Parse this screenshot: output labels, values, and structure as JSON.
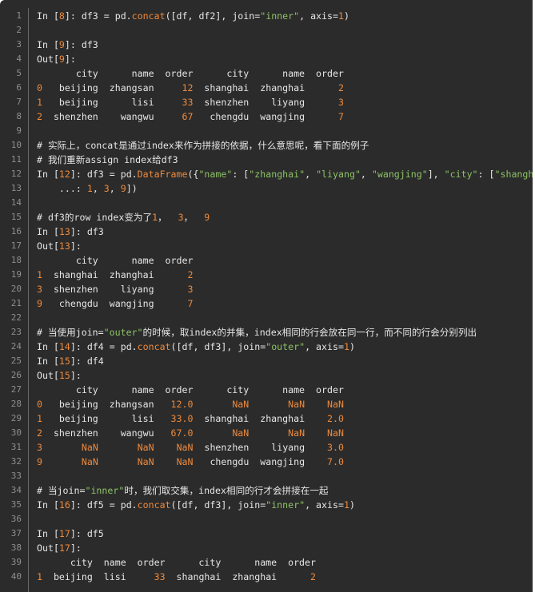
{
  "lines": [
    {
      "n": "1",
      "tokens": [
        [
          "t",
          "In ["
        ],
        [
          "n",
          "8"
        ],
        [
          "t",
          "]: df3 = pd."
        ],
        [
          "f",
          "concat"
        ],
        [
          "t",
          "([df, df2], join="
        ],
        [
          "s",
          "\"inner\""
        ],
        [
          "t",
          ", axis="
        ],
        [
          "n",
          "1"
        ],
        [
          "t",
          ")"
        ]
      ]
    },
    {
      "n": "2",
      "tokens": []
    },
    {
      "n": "3",
      "tokens": [
        [
          "t",
          "In ["
        ],
        [
          "n",
          "9"
        ],
        [
          "t",
          "]: df3"
        ]
      ]
    },
    {
      "n": "4",
      "tokens": [
        [
          "t",
          "Out["
        ],
        [
          "n",
          "9"
        ],
        [
          "t",
          "]:"
        ]
      ]
    },
    {
      "n": "5",
      "tokens": [
        [
          "t",
          "       city      name  order      city      name  order"
        ]
      ]
    },
    {
      "n": "6",
      "tokens": [
        [
          "n",
          "0"
        ],
        [
          "t",
          "   beijing  zhangsan     "
        ],
        [
          "n",
          "12"
        ],
        [
          "t",
          "  shanghai  zhanghai      "
        ],
        [
          "n",
          "2"
        ]
      ]
    },
    {
      "n": "7",
      "tokens": [
        [
          "n",
          "1"
        ],
        [
          "t",
          "   beijing      lisi     "
        ],
        [
          "n",
          "33"
        ],
        [
          "t",
          "  shenzhen    liyang      "
        ],
        [
          "n",
          "3"
        ]
      ]
    },
    {
      "n": "8",
      "tokens": [
        [
          "n",
          "2"
        ],
        [
          "t",
          "  shenzhen    wangwu     "
        ],
        [
          "n",
          "67"
        ],
        [
          "t",
          "   chengdu  wangjing      "
        ],
        [
          "n",
          "7"
        ]
      ]
    },
    {
      "n": "9",
      "tokens": []
    },
    {
      "n": "10",
      "tokens": [
        [
          "c",
          "# 实际上，concat是通过index来作为拼接的依据，什么意思呢，看下面的例子"
        ]
      ]
    },
    {
      "n": "11",
      "tokens": [
        [
          "c",
          "# 我们重新assign index给df3"
        ]
      ]
    },
    {
      "n": "12",
      "tokens": [
        [
          "t",
          "In ["
        ],
        [
          "n",
          "12"
        ],
        [
          "t",
          "]: df3 = pd."
        ],
        [
          "f",
          "DataFrame"
        ],
        [
          "t",
          "({"
        ],
        [
          "s",
          "\"name\""
        ],
        [
          "t",
          ": ["
        ],
        [
          "s",
          "\"zhanghai\""
        ],
        [
          "t",
          ", "
        ],
        [
          "s",
          "\"liyang\""
        ],
        [
          "t",
          ", "
        ],
        [
          "s",
          "\"wangjing\""
        ],
        [
          "t",
          "], "
        ],
        [
          "s",
          "\"city\""
        ],
        [
          "t",
          ": ["
        ],
        [
          "s",
          "\"shanghai\""
        ],
        [
          "t",
          ","
        ]
      ]
    },
    {
      "n": "13",
      "tokens": [
        [
          "t",
          "    ...: "
        ],
        [
          "n",
          "1"
        ],
        [
          "t",
          ", "
        ],
        [
          "n",
          "3"
        ],
        [
          "t",
          ", "
        ],
        [
          "n",
          "9"
        ],
        [
          "t",
          "])"
        ]
      ]
    },
    {
      "n": "14",
      "tokens": []
    },
    {
      "n": "15",
      "tokens": [
        [
          "c",
          "# df3的row index变为了"
        ],
        [
          "n",
          "1"
        ],
        [
          "c",
          "，  "
        ],
        [
          "n",
          "3"
        ],
        [
          "c",
          "，  "
        ],
        [
          "n",
          "9"
        ]
      ]
    },
    {
      "n": "16",
      "tokens": [
        [
          "t",
          "In ["
        ],
        [
          "n",
          "13"
        ],
        [
          "t",
          "]: df3"
        ]
      ]
    },
    {
      "n": "17",
      "tokens": [
        [
          "t",
          "Out["
        ],
        [
          "n",
          "13"
        ],
        [
          "t",
          "]:"
        ]
      ]
    },
    {
      "n": "18",
      "tokens": [
        [
          "t",
          "       city      name  order"
        ]
      ]
    },
    {
      "n": "19",
      "tokens": [
        [
          "n",
          "1"
        ],
        [
          "t",
          "  shanghai  zhanghai      "
        ],
        [
          "n",
          "2"
        ]
      ]
    },
    {
      "n": "20",
      "tokens": [
        [
          "n",
          "3"
        ],
        [
          "t",
          "  shenzhen    liyang      "
        ],
        [
          "n",
          "3"
        ]
      ]
    },
    {
      "n": "21",
      "tokens": [
        [
          "n",
          "9"
        ],
        [
          "t",
          "   chengdu  wangjing      "
        ],
        [
          "n",
          "7"
        ]
      ]
    },
    {
      "n": "22",
      "tokens": []
    },
    {
      "n": "23",
      "tokens": [
        [
          "c",
          "# 当使用join="
        ],
        [
          "s",
          "\"outer\""
        ],
        [
          "c",
          "的时候，取index的并集，index相同的行会放在同一行，而不同的行会分别列出"
        ]
      ]
    },
    {
      "n": "24",
      "tokens": [
        [
          "t",
          "In ["
        ],
        [
          "n",
          "14"
        ],
        [
          "t",
          "]: df4 = pd."
        ],
        [
          "f",
          "concat"
        ],
        [
          "t",
          "([df, df3], join="
        ],
        [
          "s",
          "\"outer\""
        ],
        [
          "t",
          ", axis="
        ],
        [
          "n",
          "1"
        ],
        [
          "t",
          ")"
        ]
      ]
    },
    {
      "n": "25",
      "tokens": [
        [
          "t",
          "In ["
        ],
        [
          "n",
          "15"
        ],
        [
          "t",
          "]: df4"
        ]
      ]
    },
    {
      "n": "26",
      "tokens": [
        [
          "t",
          "Out["
        ],
        [
          "n",
          "15"
        ],
        [
          "t",
          "]:"
        ]
      ]
    },
    {
      "n": "27",
      "tokens": [
        [
          "t",
          "       city      name  order      city      name  order"
        ]
      ]
    },
    {
      "n": "28",
      "tokens": [
        [
          "n",
          "0"
        ],
        [
          "t",
          "   beijing  zhangsan   "
        ],
        [
          "n",
          "12.0"
        ],
        [
          "t",
          "       "
        ],
        [
          "n",
          "NaN"
        ],
        [
          "t",
          "       "
        ],
        [
          "n",
          "NaN"
        ],
        [
          "t",
          "    "
        ],
        [
          "n",
          "NaN"
        ]
      ]
    },
    {
      "n": "29",
      "tokens": [
        [
          "n",
          "1"
        ],
        [
          "t",
          "   beijing      lisi   "
        ],
        [
          "n",
          "33.0"
        ],
        [
          "t",
          "  shanghai  zhanghai    "
        ],
        [
          "n",
          "2.0"
        ]
      ]
    },
    {
      "n": "30",
      "tokens": [
        [
          "n",
          "2"
        ],
        [
          "t",
          "  shenzhen    wangwu   "
        ],
        [
          "n",
          "67.0"
        ],
        [
          "t",
          "       "
        ],
        [
          "n",
          "NaN"
        ],
        [
          "t",
          "       "
        ],
        [
          "n",
          "NaN"
        ],
        [
          "t",
          "    "
        ],
        [
          "n",
          "NaN"
        ]
      ]
    },
    {
      "n": "31",
      "tokens": [
        [
          "n",
          "3"
        ],
        [
          "t",
          "       "
        ],
        [
          "n",
          "NaN"
        ],
        [
          "t",
          "       "
        ],
        [
          "n",
          "NaN"
        ],
        [
          "t",
          "    "
        ],
        [
          "n",
          "NaN"
        ],
        [
          "t",
          "  shenzhen    liyang    "
        ],
        [
          "n",
          "3.0"
        ]
      ]
    },
    {
      "n": "32",
      "tokens": [
        [
          "n",
          "9"
        ],
        [
          "t",
          "       "
        ],
        [
          "n",
          "NaN"
        ],
        [
          "t",
          "       "
        ],
        [
          "n",
          "NaN"
        ],
        [
          "t",
          "    "
        ],
        [
          "n",
          "NaN"
        ],
        [
          "t",
          "   chengdu  wangjing    "
        ],
        [
          "n",
          "7.0"
        ]
      ]
    },
    {
      "n": "33",
      "tokens": []
    },
    {
      "n": "34",
      "tokens": [
        [
          "c",
          "# 当join="
        ],
        [
          "s",
          "\"inner\""
        ],
        [
          "c",
          "时，我们取交集，index相同的行才会拼接在一起"
        ]
      ]
    },
    {
      "n": "35",
      "tokens": [
        [
          "t",
          "In ["
        ],
        [
          "n",
          "16"
        ],
        [
          "t",
          "]: df5 = pd."
        ],
        [
          "f",
          "concat"
        ],
        [
          "t",
          "([df, df3], join="
        ],
        [
          "s",
          "\"inner\""
        ],
        [
          "t",
          ", axis="
        ],
        [
          "n",
          "1"
        ],
        [
          "t",
          ")"
        ]
      ]
    },
    {
      "n": "36",
      "tokens": []
    },
    {
      "n": "37",
      "tokens": [
        [
          "t",
          "In ["
        ],
        [
          "n",
          "17"
        ],
        [
          "t",
          "]: df5"
        ]
      ]
    },
    {
      "n": "38",
      "tokens": [
        [
          "t",
          "Out["
        ],
        [
          "n",
          "17"
        ],
        [
          "t",
          "]:"
        ]
      ]
    },
    {
      "n": "39",
      "tokens": [
        [
          "t",
          "      city  name  order      city      name  order"
        ]
      ]
    },
    {
      "n": "40",
      "tokens": [
        [
          "n",
          "1"
        ],
        [
          "t",
          "  beijing  lisi     "
        ],
        [
          "n",
          "33"
        ],
        [
          "t",
          "  shanghai  zhanghai      "
        ],
        [
          "n",
          "2"
        ]
      ]
    }
  ]
}
